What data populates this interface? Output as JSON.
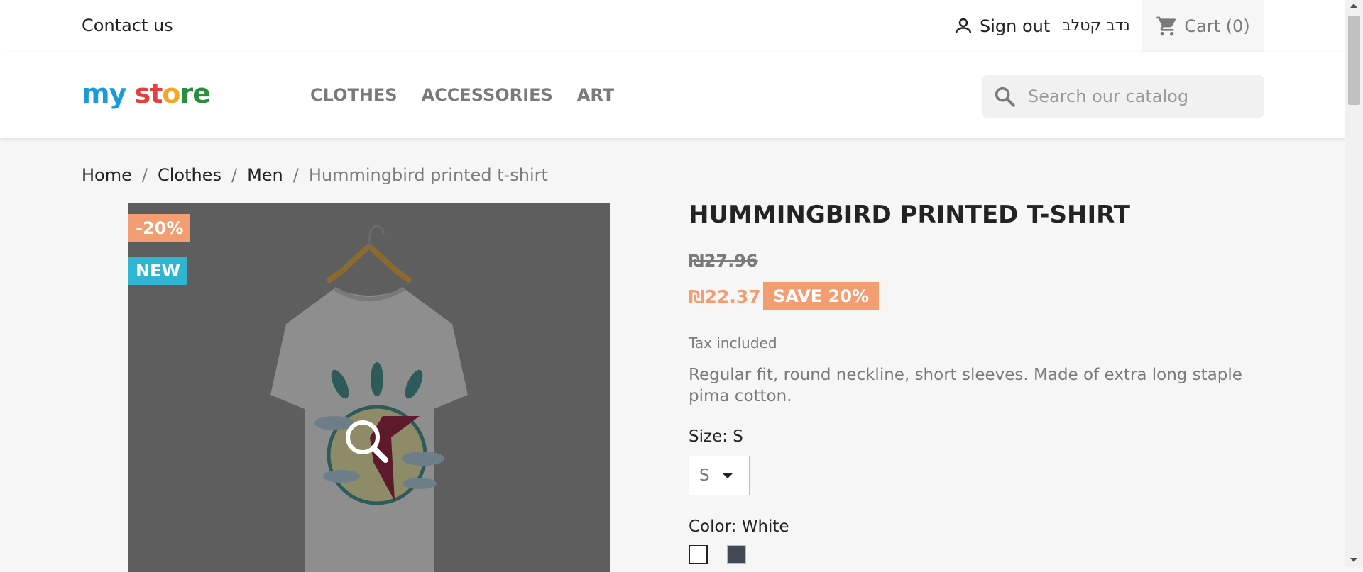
{
  "topbar": {
    "contact_label": "Contact us",
    "signout_label": "Sign out",
    "username": "נדב קטלב",
    "cart_label": "Cart (0)",
    "user_icon": "person-icon",
    "cart_icon": "shopping-cart-icon"
  },
  "header": {
    "logo_parts": [
      "my",
      " ",
      "st",
      "o",
      "re"
    ],
    "menu": [
      {
        "label": "CLOTHES"
      },
      {
        "label": "ACCESSORIES"
      },
      {
        "label": "ART"
      }
    ],
    "search": {
      "placeholder": "Search our catalog",
      "value": "",
      "icon": "search-icon"
    }
  },
  "breadcrumb": {
    "items": [
      "Home",
      "Clothes",
      "Men"
    ],
    "current": "Hummingbird printed t-shirt"
  },
  "product": {
    "image": {
      "badges": {
        "discount": "-20%",
        "new": "NEW"
      },
      "zoom_icon": "magnifier-icon"
    },
    "title": "Hummingbird printed t-shirt",
    "regular_price": "₪27.96",
    "current_price": "₪22.37",
    "save_label": "SAVE 20%",
    "tax_note": "Tax included",
    "description": "Regular fit, round neckline, short sleeves. Made of extra long staple pima cotton.",
    "size": {
      "label": "Size: S",
      "value": "S"
    },
    "color": {
      "label": "Color: White",
      "swatches": [
        {
          "name": "White",
          "hex": "#ffffff",
          "selected": true
        },
        {
          "name": "Black",
          "hex": "#434a54",
          "selected": false
        }
      ]
    }
  },
  "colors": {
    "accent": "#2fb5d2",
    "discount": "#f39d72",
    "text": "#232323",
    "muted": "#7a7a7a"
  }
}
